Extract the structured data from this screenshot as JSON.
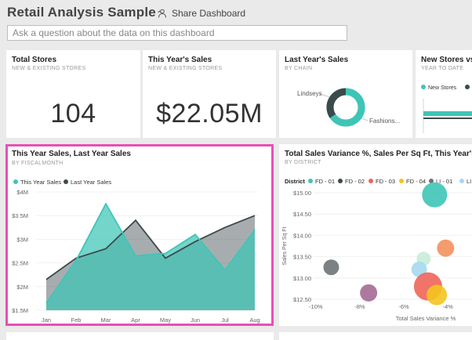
{
  "header": {
    "title": "Retail Analysis Sample",
    "share_label": "Share Dashboard",
    "qa_placeholder": "Ask a question about the data on this dashboard"
  },
  "tiles": {
    "total_stores": {
      "title": "Total Stores",
      "subtitle": "NEW & EXISTING STORES",
      "value": "104"
    },
    "this_year_sales": {
      "title": "This Year's Sales",
      "subtitle": "NEW & EXISTING STORES",
      "value": "$22.05M"
    },
    "last_year_sales": {
      "title": "Last Year's Sales",
      "subtitle": "BY CHAIN",
      "label_a": "Lindseys",
      "label_b": "Fashions..."
    },
    "new_stores": {
      "title": "New Stores vs. L",
      "subtitle": "YEAR TO DATE",
      "legend_a": "New Stores"
    },
    "area_chart": {
      "title": "This Year Sales, Last Year Sales",
      "subtitle": "BY FISCALMONTH"
    },
    "scatter_chart": {
      "title": "Total Sales Variance %, Sales Per Sq Ft, This Year's Sales",
      "subtitle": "BY DISTRICT"
    }
  },
  "colors": {
    "teal": "#3ec5b7",
    "dark": "#3b4a4b",
    "highlight": "#e84fb6",
    "red": "#f0655a",
    "yellow": "#f4c41f",
    "gray": "#6d7475",
    "lightblue": "#a5d9f0",
    "orange": "#f4915e",
    "purple": "#a56a93"
  },
  "chart_data": [
    {
      "type": "area",
      "title": "This Year Sales, Last Year Sales",
      "subtitle": "BY FISCALMONTH",
      "categories": [
        "Jan",
        "Feb",
        "Mar",
        "Apr",
        "May",
        "Jun",
        "Jul",
        "Aug"
      ],
      "series": [
        {
          "name": "This Year Sales",
          "color": "#3ec5b7",
          "values": [
            1.65,
            2.55,
            3.75,
            2.65,
            2.7,
            3.1,
            2.35,
            3.2
          ]
        },
        {
          "name": "Last Year Sales",
          "color": "#3b4a4b",
          "values": [
            2.15,
            2.6,
            2.8,
            3.4,
            2.6,
            2.95,
            3.25,
            3.5
          ]
        }
      ],
      "yticks": [
        "$1.5M",
        "$2M",
        "$2.5M",
        "$3M",
        "$3.5M",
        "$4M"
      ],
      "ylim": [
        1.5,
        4.0
      ],
      "legend": "top-left"
    },
    {
      "type": "scatter",
      "title": "Total Sales Variance %, Sales Per Sq Ft, This Year's Sales",
      "subtitle": "BY DISTRICT",
      "xlabel": "Total Sales Variance %",
      "ylabel": "Sales Per Sq Ft",
      "legend_title": "District",
      "legend": [
        {
          "name": "FD - 01",
          "color": "#3ec5b7"
        },
        {
          "name": "FD - 02",
          "color": "#3b4a4b"
        },
        {
          "name": "FD - 03",
          "color": "#f0655a"
        },
        {
          "name": "FD - 04",
          "color": "#f4c41f"
        },
        {
          "name": "LI - 01",
          "color": "#6d7475"
        },
        {
          "name": "LI",
          "color": "#a5d9f0"
        }
      ],
      "xticks": [
        "-10%",
        "-8%",
        "-6%",
        "-4%"
      ],
      "xvals": [
        -10,
        -8,
        -6,
        -4
      ],
      "yticks": [
        "$12.50",
        "$13.00",
        "$13.50",
        "$14.00",
        "$14.50",
        "$15.00"
      ],
      "yvals": [
        12.5,
        13.0,
        13.5,
        14.0,
        14.5,
        15.0
      ],
      "xlim": [
        -10.1,
        -2.9
      ],
      "ylim": [
        12.5,
        15.0
      ],
      "points": [
        {
          "x": -4.6,
          "y": 14.95,
          "size": 16,
          "color": "#3ec5b7"
        },
        {
          "x": -4.1,
          "y": 13.7,
          "size": 11,
          "color": "#f4915e"
        },
        {
          "x": -5.1,
          "y": 13.45,
          "size": 9,
          "color": "#c7ecd9"
        },
        {
          "x": -9.3,
          "y": 13.25,
          "size": 10,
          "color": "#6d7475"
        },
        {
          "x": -5.3,
          "y": 13.2,
          "size": 10,
          "color": "#a5d9f0"
        },
        {
          "x": -4.9,
          "y": 12.8,
          "size": 18,
          "color": "#f0655a"
        },
        {
          "x": -4.5,
          "y": 12.6,
          "size": 13,
          "color": "#f4c41f"
        },
        {
          "x": -7.6,
          "y": 12.65,
          "size": 11,
          "color": "#a56a93"
        }
      ]
    }
  ]
}
